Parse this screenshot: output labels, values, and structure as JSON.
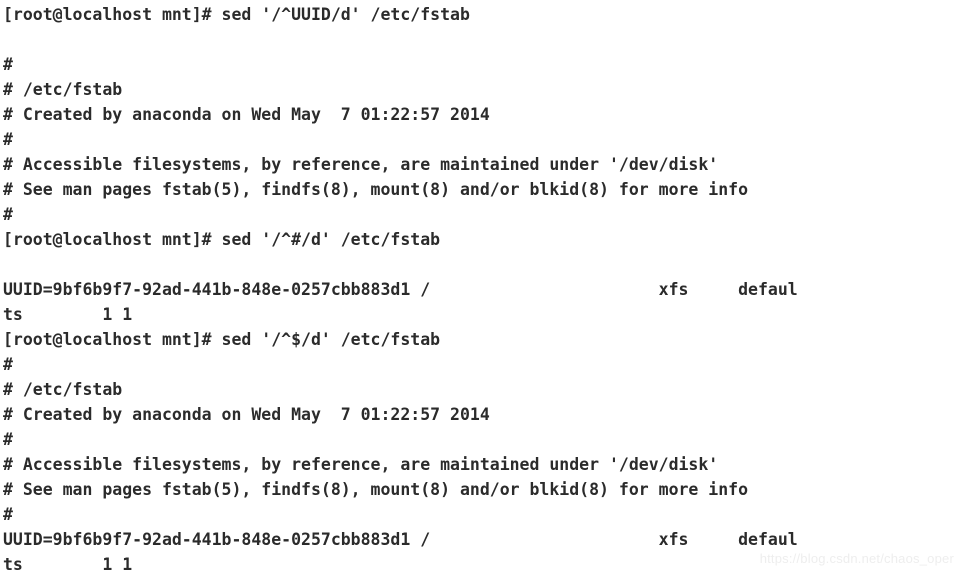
{
  "window": {
    "kind": "terminal",
    "background_color": "#ffffff",
    "text_color": "#2b2b2b"
  },
  "terminal": {
    "prompt": "[root@localhost mnt]#",
    "commands": [
      "sed '/^UUID/d' /etc/fstab",
      "sed '/^#/d' /etc/fstab",
      "sed '/^$/d' /etc/fstab"
    ],
    "lines": [
      "[root@localhost mnt]# sed '/^UUID/d' /etc/fstab",
      "",
      "#",
      "# /etc/fstab",
      "# Created by anaconda on Wed May  7 01:22:57 2014",
      "#",
      "# Accessible filesystems, by reference, are maintained under '/dev/disk'",
      "# See man pages fstab(5), findfs(8), mount(8) and/or blkid(8) for more info",
      "#",
      "[root@localhost mnt]# sed '/^#/d' /etc/fstab",
      "",
      "UUID=9bf6b9f7-92ad-441b-848e-0257cbb883d1 /                       xfs     defaul",
      "ts        1 1",
      "[root@localhost mnt]# sed '/^$/d' /etc/fstab",
      "#",
      "# /etc/fstab",
      "# Created by anaconda on Wed May  7 01:22:57 2014",
      "#",
      "# Accessible filesystems, by reference, are maintained under '/dev/disk'",
      "# See man pages fstab(5), findfs(8), mount(8) and/or blkid(8) for more info",
      "#",
      "UUID=9bf6b9f7-92ad-441b-848e-0257cbb883d1 /                       xfs     defaul",
      "ts        1 1"
    ]
  },
  "watermark": {
    "text": "https://blog.csdn.net/chaos_oper",
    "color": "#eeeeee"
  }
}
